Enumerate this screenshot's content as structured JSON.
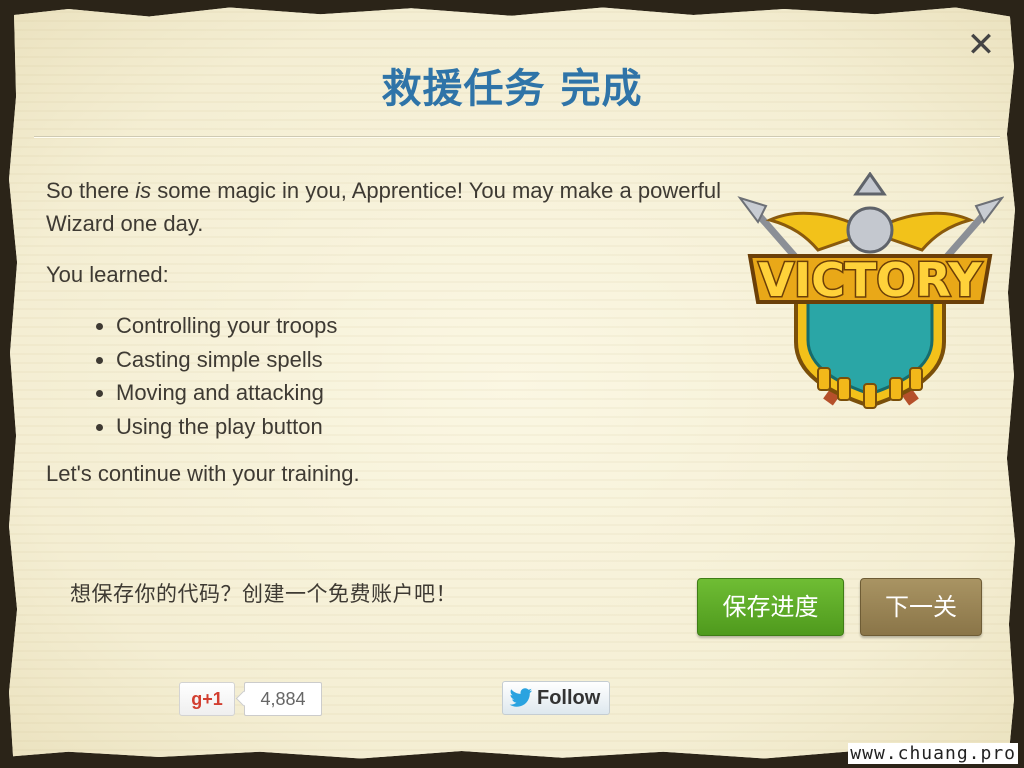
{
  "modal": {
    "title": "救援任务 完成",
    "close_icon": "close-icon",
    "intro": {
      "before": "So there ",
      "emphasis": "is",
      "after": " some magic in you, Apprentice! You may make a powerful Wizard one day."
    },
    "learned_heading": "You learned:",
    "learned_items": [
      "Controlling your troops",
      "Casting simple spells",
      "Moving and attacking",
      "Using the play button"
    ],
    "closing": "Let's continue with your training.",
    "badge": {
      "text": "VICTORY",
      "icon": "victory-badge-icon"
    }
  },
  "footer": {
    "save_prompt": "想保存你的代码？创建一个免费账户吧！",
    "save_button": "保存进度",
    "next_button": "下一关"
  },
  "social": {
    "gplus_label": "+1",
    "gplus_icon": "google-plus-icon",
    "gplus_count": "4,884",
    "twitter_label": "Follow",
    "twitter_icon": "twitter-bird-icon"
  },
  "watermark": "www.chuang.pro",
  "colors": {
    "parchment": "#f6f1d9",
    "title": "#2f74a8",
    "save_button": "#5fac28",
    "next_button": "#9b8656"
  }
}
